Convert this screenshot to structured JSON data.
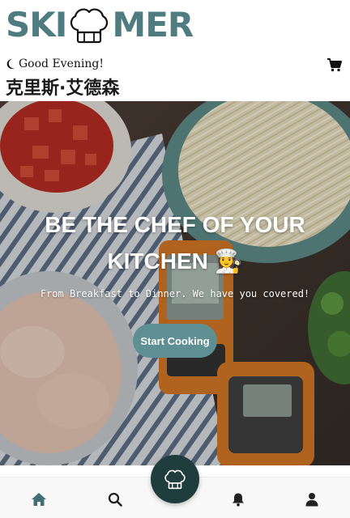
{
  "header": {
    "logo_left": "SKI",
    "logo_right": "MER",
    "greeting": "Good Evening!",
    "user_name": "克里斯·艾德森"
  },
  "hero": {
    "title_line1": "BE THE CHEF OF YOUR",
    "title_line2": "KITCHEN 👩‍🍳",
    "subtitle": "From Breakfast to Dinner. We have you covered!",
    "cta_label": "Start Cooking"
  },
  "bottom_nav": {
    "items": [
      "home-icon",
      "search-icon",
      "chef-hat-icon",
      "bell-icon",
      "profile-icon"
    ],
    "active": "home"
  },
  "colors": {
    "brand": "#4e7c80",
    "cta": "#5e8f93",
    "fab": "#1f3d3d",
    "active_nav": "#3f6f73"
  }
}
